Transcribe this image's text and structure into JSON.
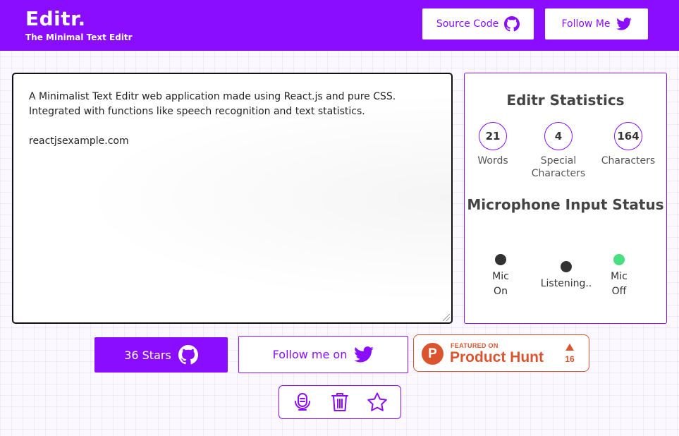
{
  "header": {
    "title": "Editr.",
    "subtitle": "The Minimal Text Editr",
    "source_code_label": "Source Code",
    "follow_me_label": "Follow Me"
  },
  "editor": {
    "line1": "A Minimalist Text Editr web application made using React.js and pure CSS.",
    "line2": "Integrated with functions like speech recognition and text statistics.",
    "line3": "reactjsexample.com"
  },
  "statistics": {
    "title": "Editr Statistics",
    "words": {
      "value": "21",
      "label": "Words"
    },
    "special": {
      "value": "4",
      "label": "Special Characters"
    },
    "characters": {
      "value": "164",
      "label": "Characters"
    }
  },
  "microphone": {
    "title": "Microphone Input Status",
    "items": [
      {
        "label": "Mic On",
        "color": "#333333"
      },
      {
        "label": "Listening..",
        "color": "#333333"
      },
      {
        "label": "Mic Off",
        "color": "#4ade80"
      }
    ]
  },
  "actions": {
    "stars_label": "36 Stars",
    "follow_label": "Follow me on"
  },
  "product_hunt": {
    "featured": "FEATURED ON",
    "name": "Product Hunt",
    "count": "16",
    "logo_letter": "P"
  },
  "toolbar": {
    "icons": [
      "microphone-icon",
      "trash-icon",
      "star-icon"
    ]
  },
  "colors": {
    "accent": "#8a0dff",
    "product_hunt": "#da552f",
    "mic_off": "#4ade80"
  }
}
